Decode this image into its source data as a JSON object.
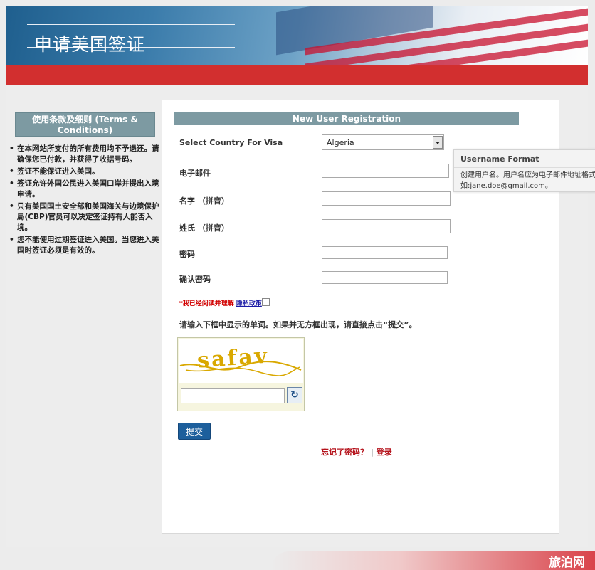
{
  "header": {
    "title": "申请美国签证"
  },
  "sidebar": {
    "heading": "使用条款及细则 (Terms & Conditions)",
    "terms": [
      "在本网站所支付的所有费用均不予退还。请确保您已付款，并获得了收据号码。",
      "签证不能保证进入美国。",
      "签证允许外国公民进入美国口岸并提出入境申请。",
      "只有美国国土安全部和美国海关与边境保护局(CBP)官员可以决定签证持有人能否入境。",
      "您不能使用过期签证进入美国。当您进入美国时签证必须是有效的。"
    ]
  },
  "form": {
    "heading": "New User Registration",
    "country_label": "Select Country For Visa",
    "country_value": "Algeria",
    "email_label": "电子邮件",
    "given_name_label": "名字 （拼音）",
    "surname_label": "姓氏 （拼音）",
    "password_label": "密码",
    "confirm_password_label": "确认密码",
    "agree_text": "*我已经阅读并理解",
    "privacy_link": "隐私政策",
    "captcha_instruction": "请输入下框中显示的单词。如果并无方框出现，请直接点击“提交”。",
    "captcha_word": "safav",
    "submit_label": "提交",
    "forgot_password": "忘记了密码？",
    "separator": "|",
    "login": "登录"
  },
  "tooltip": {
    "title": "Username Format",
    "line1": "创建用户名。用户名应为电子邮件地址格式",
    "line2": "如:jane.doe@gmail.com。"
  },
  "watermark": "旅泊网",
  "colors": {
    "red_bar": "#d22f2f",
    "header_band": "#7d9aa2",
    "submit_button": "#1d5f9c",
    "link_red": "#b5121b"
  }
}
